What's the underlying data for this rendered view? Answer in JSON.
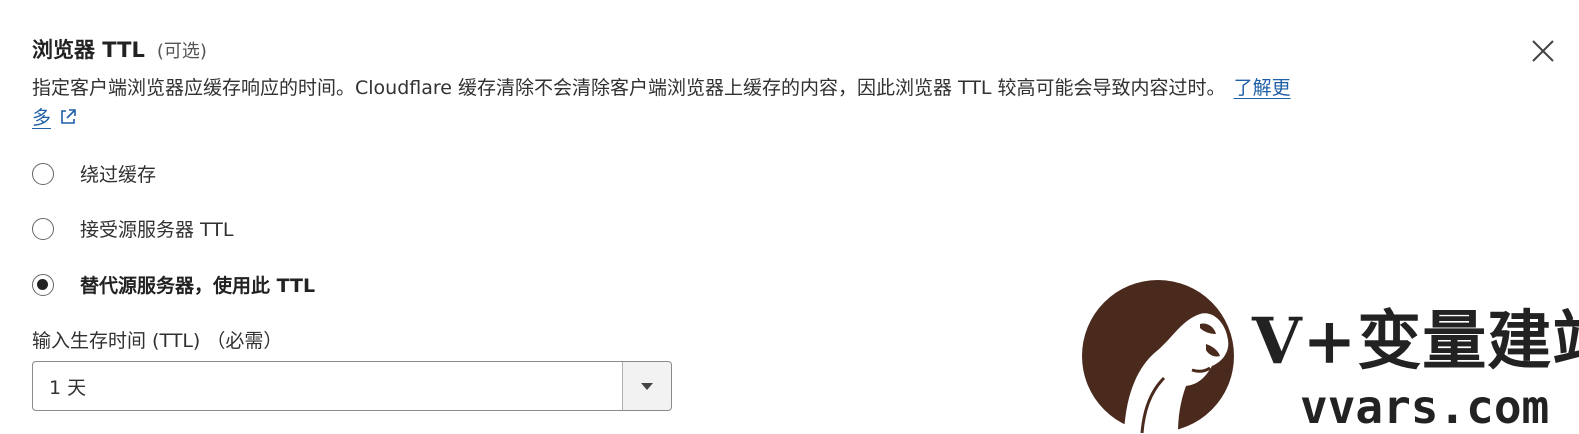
{
  "header": {
    "title": "浏览器 TTL",
    "optional": "(可选)"
  },
  "description": {
    "text": "指定客户端浏览器应缓存响应的时间。Cloudflare 缓存清除不会清除客户端浏览器上缓存的内容，因此浏览器 TTL 较高可能会导致内容过时。",
    "learn_more": "了解更多"
  },
  "options": [
    {
      "label": "绕过缓存",
      "checked": false
    },
    {
      "label": "接受源服务器 TTL",
      "checked": false
    },
    {
      "label": "替代源服务器，使用此 TTL",
      "checked": true
    }
  ],
  "ttl_field": {
    "label": "输入生存时间 (TTL) （必需）",
    "value": "1 天"
  },
  "watermark": {
    "brand": "V+变量建站",
    "domain": "vvars.com"
  },
  "colors": {
    "link": "#1f5fa6",
    "text": "#313131",
    "logo": "#4a2a1c"
  },
  "icons": [
    "close-icon",
    "external-link-icon",
    "chevron-down-icon",
    "gorilla-logo-icon"
  ]
}
